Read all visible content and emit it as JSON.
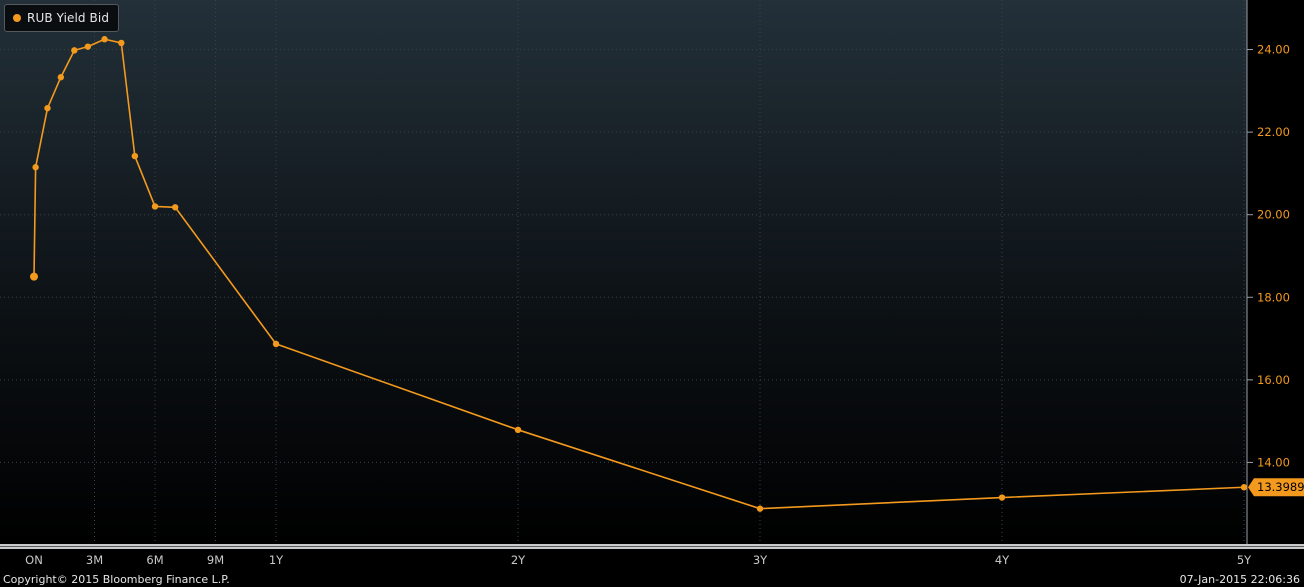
{
  "legend": {
    "label": "RUB Yield Bid",
    "color": "#f39a1e"
  },
  "footer": {
    "copyright": "Copyright© 2015 Bloomberg Finance L.P.",
    "timestamp": "07-Jan-2015 22:06:36"
  },
  "colors": {
    "series": "#f39a1e",
    "axis_text": "#c9c9c9",
    "grid": "#3a4148",
    "bg_top": "#233039",
    "bg_bottom": "#000000"
  },
  "chart_data": {
    "type": "line",
    "series": [
      {
        "name": "RUB Yield Bid",
        "x": [
          0,
          0.08,
          0.67,
          1.33,
          2,
          2.67,
          3.5,
          4.33,
          5,
          6,
          7,
          12,
          24,
          36,
          48,
          60
        ],
        "y": [
          18.5,
          21.15,
          22.58,
          23.33,
          23.98,
          24.07,
          24.25,
          24.16,
          21.42,
          20.2,
          20.18,
          16.87,
          14.79,
          12.88,
          13.15,
          13.3989
        ]
      }
    ],
    "x_tick_labels": [
      {
        "x": 0,
        "label": "ON"
      },
      {
        "x": 3,
        "label": "3M"
      },
      {
        "x": 6,
        "label": "6M"
      },
      {
        "x": 9,
        "label": "9M"
      },
      {
        "x": 12,
        "label": "1Y"
      },
      {
        "x": 24,
        "label": "2Y"
      },
      {
        "x": 36,
        "label": "3Y"
      },
      {
        "x": 48,
        "label": "4Y"
      },
      {
        "x": 60,
        "label": "5Y"
      }
    ],
    "y_ticks": [
      14.0,
      16.0,
      18.0,
      20.0,
      22.0,
      24.0
    ],
    "ylim": [
      12.0,
      25.2
    ],
    "last_value_label": "13.3989",
    "grid": true,
    "legend_position": "top-left"
  }
}
